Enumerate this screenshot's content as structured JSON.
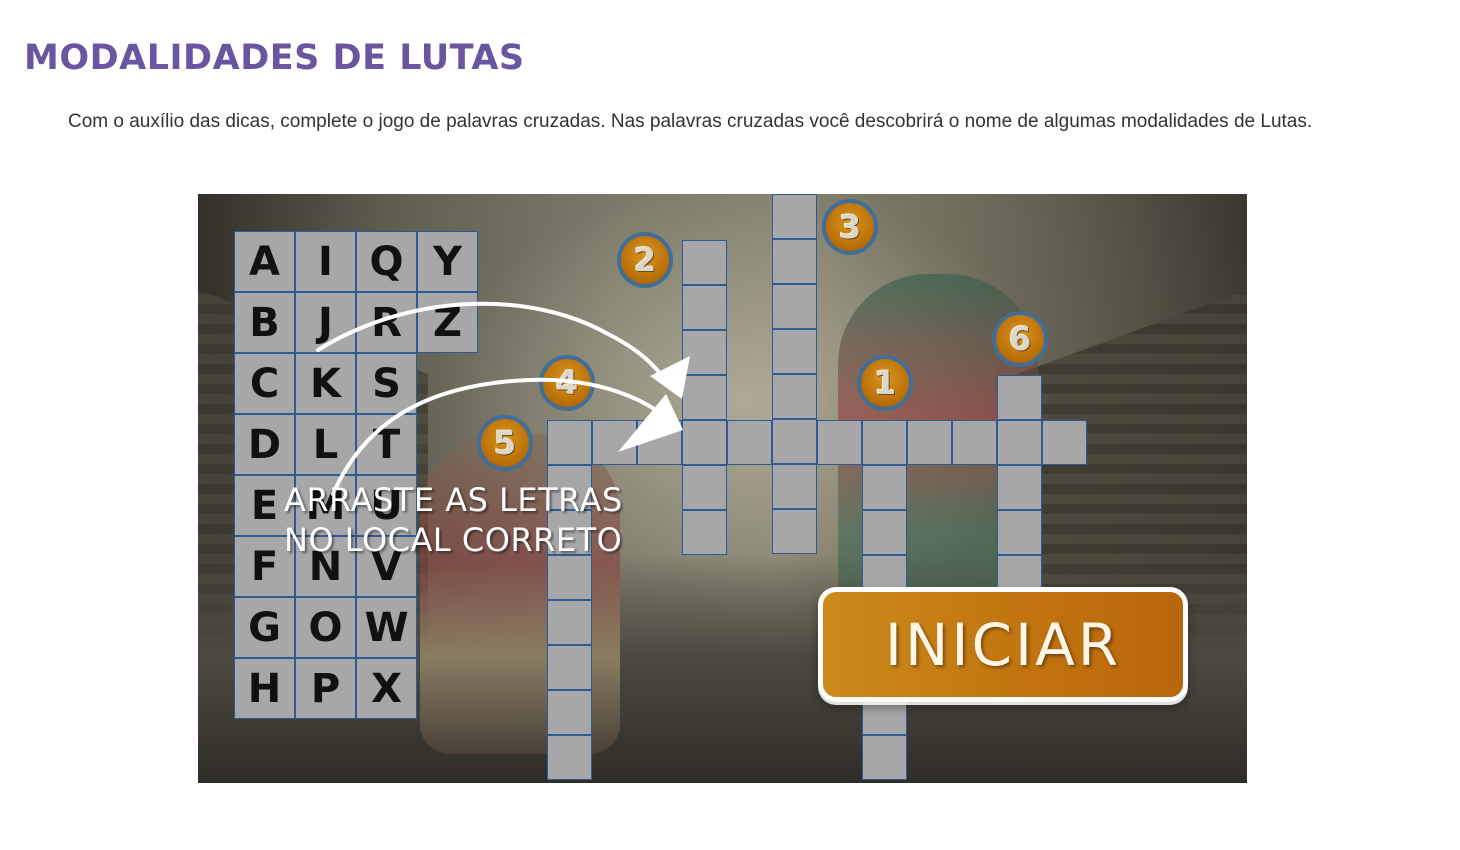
{
  "page": {
    "title": "MODALIDADES DE LUTAS",
    "intro": "Com o auxílio das dicas, complete o jogo de palavras cruzadas. Nas palavras cruzadas você descobrirá o nome de algumas modalidades de Lutas."
  },
  "game": {
    "letters": {
      "col1": [
        "A",
        "B",
        "C",
        "D",
        "E",
        "F",
        "G",
        "H"
      ],
      "col2": [
        "I",
        "J",
        "K",
        "L",
        "M",
        "N",
        "O",
        "P"
      ],
      "col3": [
        "Q",
        "R",
        "S",
        "T",
        "U",
        "V",
        "W",
        "X"
      ],
      "col4": [
        "Y",
        "Z"
      ]
    },
    "clue_numbers": [
      "1",
      "2",
      "3",
      "4",
      "5",
      "6"
    ],
    "instruction_line1": "ARRASTE AS LETRAS",
    "instruction_line2": "NO LOCAL CORRETO",
    "start_label": "INICIAR",
    "colors": {
      "title": "#6a55a0",
      "cell": "#a7a7a9",
      "cell_border": "#2c5b93",
      "badge": "#c07a10",
      "badge_ring": "#3f6e98",
      "button": "#c27610"
    },
    "icons": [
      "curved-arrow-icon",
      "curved-arrow-icon"
    ]
  }
}
